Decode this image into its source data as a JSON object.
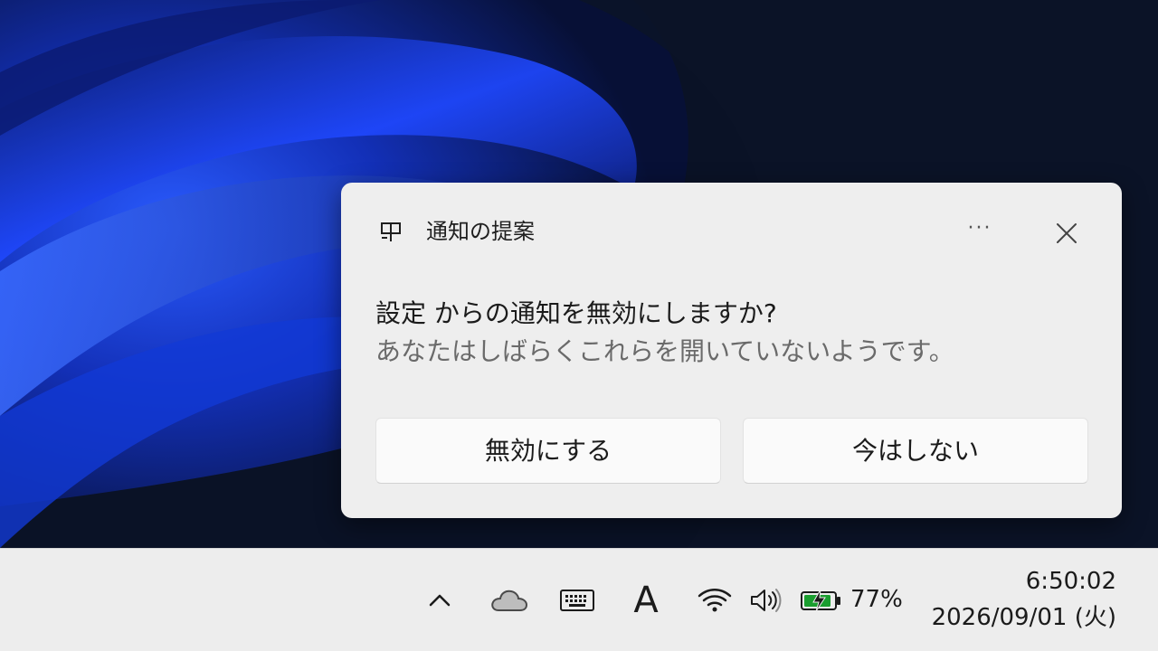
{
  "toast": {
    "app_name": "通知の提案",
    "more_label": "···",
    "title": "設定 からの通知を無効にしますか?",
    "body": "あなたはしばらくこれらを開いていないようです。",
    "buttons": {
      "disable": "無効にする",
      "later": "今はしない"
    },
    "icons": {
      "app": "notification-suggestion-icon",
      "more": "more-options-icon",
      "close": "close-icon"
    }
  },
  "taskbar": {
    "tray": {
      "chevron": "show-hidden-icons-icon",
      "cloud": "onedrive-cloud-icon",
      "keyboard": "touch-keyboard-icon",
      "ime_label": "A",
      "wifi": "wifi-icon",
      "volume": "volume-icon",
      "battery": "battery-charging-icon",
      "battery_percent": "77%"
    },
    "clock": {
      "time": "6:50:02",
      "date": "2026/09/01 (火)"
    }
  },
  "colors": {
    "wallpaper_dark": "#0b1226",
    "wallpaper_blue": "#1f4cff",
    "battery_green": "#1a9e2f",
    "toast_bg": "#eeeeee",
    "taskbar_bg": "#ededed"
  }
}
